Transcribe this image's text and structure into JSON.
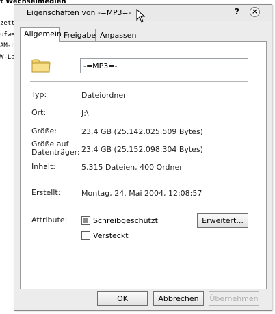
{
  "background_window": {
    "title": "t Wechselmedien",
    "list_items": [
      "zette",
      "ufwe",
      "AM-L",
      "W-La"
    ]
  },
  "dialog": {
    "title": "Eigenschaften von -=MP3=-",
    "help_glyph": "?",
    "close_glyph": "×",
    "tabs": [
      {
        "label": "Allgemein",
        "active": true
      },
      {
        "label": "Freigabe",
        "active": false
      },
      {
        "label": "Anpassen",
        "active": false
      }
    ],
    "folder_name": "-=MP3=-",
    "folder_icon": "folder-icon",
    "properties": {
      "type_label": "Typ:",
      "type_value": "Dateiordner",
      "location_label": "Ort:",
      "location_value": "J:\\",
      "size_label": "Größe:",
      "size_value": "23,4 GB (25.142.025.509 Bytes)",
      "size_on_disk_label_line1": "Größe auf",
      "size_on_disk_label_line2": "Datenträger:",
      "size_on_disk_value": "23,4 GB (25.152.098.304 Bytes)",
      "contents_label": "Inhalt:",
      "contents_value": "5.315 Dateien, 400 Ordner",
      "created_label": "Erstellt:",
      "created_value": "Montag, 24. Mai 2004, 12:08:57"
    },
    "attributes": {
      "label": "Attribute:",
      "readonly_label": "Schreibgeschützt",
      "readonly_state": "indeterminate",
      "hidden_label": "Versteckt",
      "hidden_state": "unchecked",
      "advanced_button": "Erweitert..."
    },
    "buttons": {
      "ok": "OK",
      "cancel": "Abbrechen",
      "apply": "Übernehmen"
    }
  }
}
